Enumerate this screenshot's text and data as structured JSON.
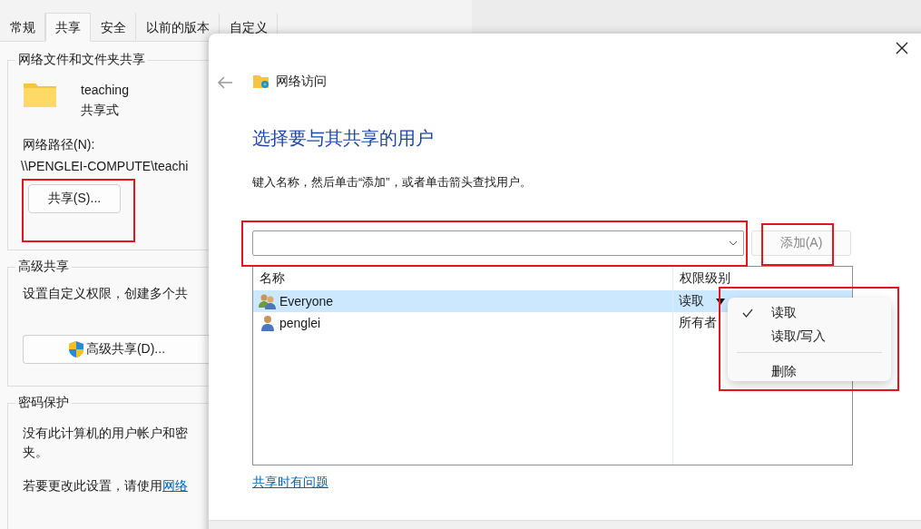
{
  "properties_window": {
    "tabs": [
      {
        "label": "常规",
        "selected": false
      },
      {
        "label": "共享",
        "selected": true
      },
      {
        "label": "安全",
        "selected": false
      },
      {
        "label": "以前的版本",
        "selected": false
      },
      {
        "label": "自定义",
        "selected": false
      }
    ],
    "sharing_group": {
      "title": "网络文件和文件夹共享",
      "folder_name": "teaching",
      "folder_status": "共享式",
      "path_label": "网络路径(N):",
      "path": "\\\\PENGLEI-COMPUTE\\teachi",
      "share_button": "共享(S)..."
    },
    "advanced_group": {
      "title": "高级共享",
      "description": "设置自定义权限，创建多个共",
      "button": "高级共享(D)..."
    },
    "password_group": {
      "title": "密码保护",
      "description": "没有此计算机的用户帐户和密",
      "description_end": "夹。",
      "change_note": "若要更改此设置，请使用",
      "link": "网络"
    }
  },
  "dialog": {
    "title": "网络访问",
    "heading": "选择要与其共享的用户",
    "instruction": "键入名称，然后单击“添加”，或者单击箭头查找用户。",
    "add_button": {
      "label": "添加(A)",
      "disabled": true
    },
    "table": {
      "columns": [
        "名称",
        "权限级别"
      ],
      "rows": [
        {
          "name": "Everyone",
          "kind": "group",
          "permission": "读取",
          "selected": true
        },
        {
          "name": "penglei",
          "kind": "user",
          "permission": "所有者",
          "selected": false
        }
      ]
    },
    "menu": {
      "items": [
        {
          "kind": "option",
          "label": "读取",
          "checked": true
        },
        {
          "kind": "option",
          "label": "读取/写入",
          "checked": false
        },
        {
          "kind": "separator"
        },
        {
          "kind": "option",
          "label": "删除",
          "checked": false
        }
      ]
    },
    "help_link": "共享时有问题"
  }
}
